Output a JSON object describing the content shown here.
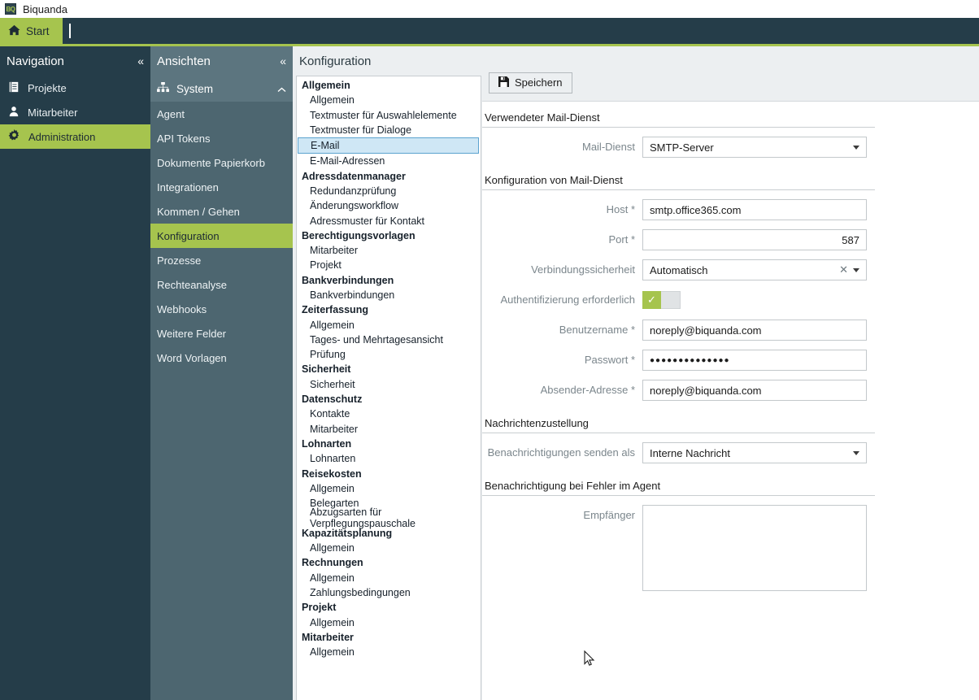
{
  "window": {
    "title": "Biquanda",
    "logo_text": "BQ"
  },
  "tabbar": {
    "tabs": [
      {
        "label": "Start",
        "icon": "home-icon",
        "active": true
      }
    ]
  },
  "navigation": {
    "header": "Navigation",
    "collapse_icon": "chevron-double-left-icon",
    "items": [
      {
        "label": "Projekte",
        "icon": "projects-icon",
        "active": false
      },
      {
        "label": "Mitarbeiter",
        "icon": "person-icon",
        "active": false
      },
      {
        "label": "Administration",
        "icon": "gear-icon",
        "active": true
      }
    ]
  },
  "views": {
    "header": "Ansichten",
    "collapse_icon": "chevron-double-left-icon",
    "group": {
      "label": "System",
      "icon": "sitemap-icon",
      "expand_icon": "chevron-up-icon"
    },
    "items": [
      {
        "label": "Agent",
        "active": false
      },
      {
        "label": "API Tokens",
        "active": false
      },
      {
        "label": "Dokumente Papierkorb",
        "active": false
      },
      {
        "label": "Integrationen",
        "active": false
      },
      {
        "label": "Kommen / Gehen",
        "active": false
      },
      {
        "label": "Konfiguration",
        "active": true
      },
      {
        "label": "Prozesse",
        "active": false
      },
      {
        "label": "Rechteanalyse",
        "active": false
      },
      {
        "label": "Webhooks",
        "active": false
      },
      {
        "label": "Weitere Felder",
        "active": false
      },
      {
        "label": "Word Vorlagen",
        "active": false
      }
    ]
  },
  "tree": {
    "header": "Konfiguration",
    "nodes": [
      {
        "label": "Allgemein",
        "type": "group",
        "selected": false
      },
      {
        "label": "Allgemein",
        "type": "leaf",
        "selected": false
      },
      {
        "label": "Textmuster für Auswahlelemente",
        "type": "leaf",
        "selected": false
      },
      {
        "label": "Textmuster für Dialoge",
        "type": "leaf",
        "selected": false
      },
      {
        "label": "E-Mail",
        "type": "leaf",
        "selected": true
      },
      {
        "label": "E-Mail-Adressen",
        "type": "leaf",
        "selected": false
      },
      {
        "label": "Adressdatenmanager",
        "type": "group",
        "selected": false
      },
      {
        "label": "Redundanzprüfung",
        "type": "leaf",
        "selected": false
      },
      {
        "label": "Änderungsworkflow",
        "type": "leaf",
        "selected": false
      },
      {
        "label": "Adressmuster für Kontakt",
        "type": "leaf",
        "selected": false
      },
      {
        "label": "Berechtigungsvorlagen",
        "type": "group",
        "selected": false
      },
      {
        "label": "Mitarbeiter",
        "type": "leaf",
        "selected": false
      },
      {
        "label": "Projekt",
        "type": "leaf",
        "selected": false
      },
      {
        "label": "Bankverbindungen",
        "type": "group",
        "selected": false
      },
      {
        "label": "Bankverbindungen",
        "type": "leaf",
        "selected": false
      },
      {
        "label": "Zeiterfassung",
        "type": "group",
        "selected": false
      },
      {
        "label": "Allgemein",
        "type": "leaf",
        "selected": false
      },
      {
        "label": "Tages- und Mehrtagesansicht",
        "type": "leaf",
        "selected": false
      },
      {
        "label": "Prüfung",
        "type": "leaf",
        "selected": false
      },
      {
        "label": "Sicherheit",
        "type": "group",
        "selected": false
      },
      {
        "label": "Sicherheit",
        "type": "leaf",
        "selected": false
      },
      {
        "label": "Datenschutz",
        "type": "group",
        "selected": false
      },
      {
        "label": "Kontakte",
        "type": "leaf",
        "selected": false
      },
      {
        "label": "Mitarbeiter",
        "type": "leaf",
        "selected": false
      },
      {
        "label": "Lohnarten",
        "type": "group",
        "selected": false
      },
      {
        "label": "Lohnarten",
        "type": "leaf",
        "selected": false
      },
      {
        "label": "Reisekosten",
        "type": "group",
        "selected": false
      },
      {
        "label": "Allgemein",
        "type": "leaf",
        "selected": false
      },
      {
        "label": "Belegarten",
        "type": "leaf",
        "selected": false
      },
      {
        "label": "Abzugsarten für Verpflegungspauschale",
        "type": "leaf",
        "selected": false
      },
      {
        "label": "Kapazitätsplanung",
        "type": "group",
        "selected": false
      },
      {
        "label": "Allgemein",
        "type": "leaf",
        "selected": false
      },
      {
        "label": "Rechnungen",
        "type": "group",
        "selected": false
      },
      {
        "label": "Allgemein",
        "type": "leaf",
        "selected": false
      },
      {
        "label": "Zahlungsbedingungen",
        "type": "leaf",
        "selected": false
      },
      {
        "label": "Projekt",
        "type": "group",
        "selected": false
      },
      {
        "label": "Allgemein",
        "type": "leaf",
        "selected": false
      },
      {
        "label": "Mitarbeiter",
        "type": "group",
        "selected": false
      },
      {
        "label": "Allgemein",
        "type": "leaf",
        "selected": false
      }
    ]
  },
  "toolbar": {
    "save_label": "Speichern",
    "save_icon": "save-floppy-icon"
  },
  "form": {
    "section_mail_service": "Verwendeter Mail-Dienst",
    "mail_service": {
      "label": "Mail-Dienst",
      "value": "SMTP-Server",
      "type": "select"
    },
    "section_mail_config": "Konfiguration von Mail-Dienst",
    "host": {
      "label": "Host",
      "required": "*",
      "value": "smtp.office365.com"
    },
    "port": {
      "label": "Port",
      "required": "*",
      "value": "587"
    },
    "security": {
      "label": "Verbindungssicherheit",
      "value": "Automatisch",
      "type": "select",
      "clearable": true
    },
    "auth_required": {
      "label": "Authentifizierung erforderlich",
      "value": "on",
      "type": "toggle"
    },
    "username": {
      "label": "Benutzername",
      "required": "*",
      "value": "noreply@biquanda.com"
    },
    "password": {
      "label": "Passwort",
      "required": "*",
      "value": "●●●●●●●●●●●●●●"
    },
    "sender_address": {
      "label": "Absender-Adresse",
      "required": "*",
      "value": "noreply@biquanda.com"
    },
    "section_delivery": "Nachrichtenzustellung",
    "notify_as": {
      "label": "Benachrichtigungen senden als",
      "value": "Interne Nachricht",
      "type": "select"
    },
    "section_agent_error": "Benachrichtigung bei Fehler im Agent",
    "recipients": {
      "label": "Empfänger",
      "value": "",
      "type": "textarea"
    }
  },
  "colors": {
    "accent_green": "#a6c44e",
    "dark_navy": "#253d49",
    "panel_slate": "#4d6670",
    "selection_blue": "#cfe7f5"
  }
}
